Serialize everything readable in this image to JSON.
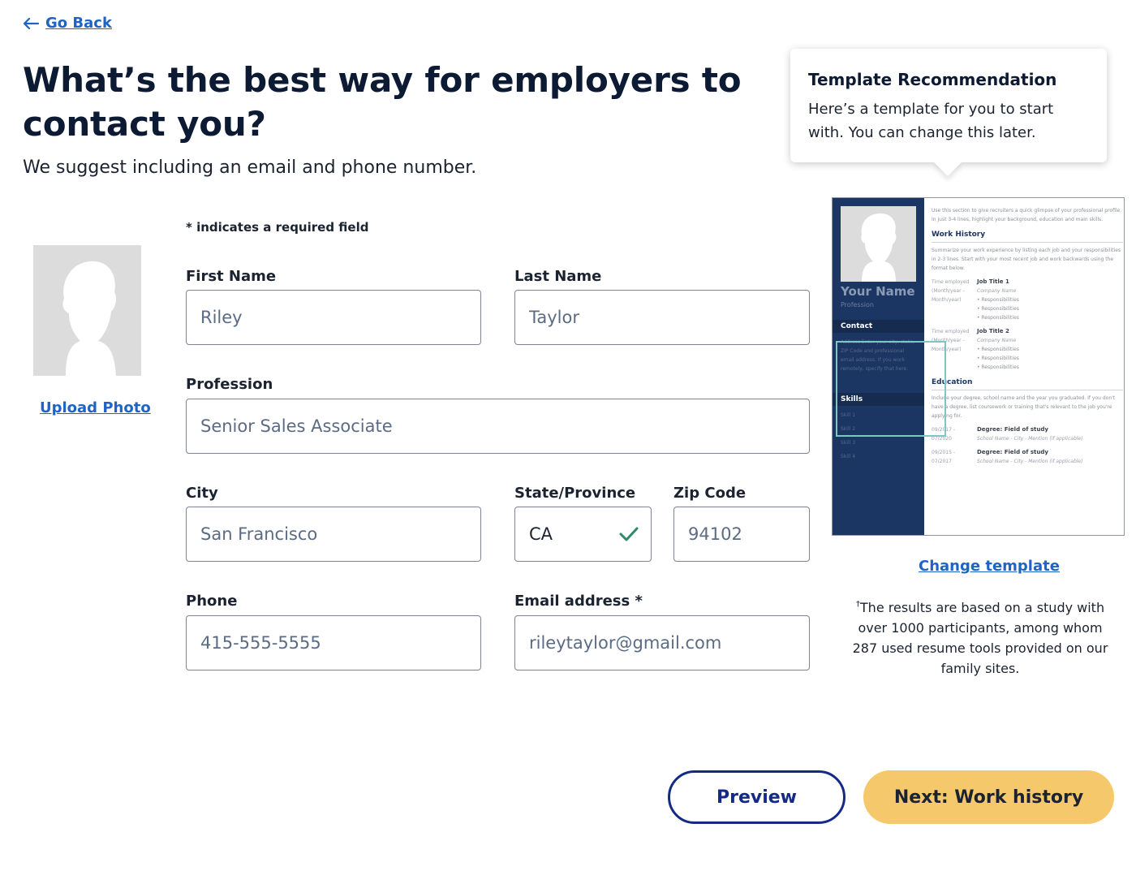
{
  "nav": {
    "back_label": "Go Back"
  },
  "header": {
    "title": "What’s the best way for employers to contact you?",
    "subtitle": "We suggest including an email and phone number."
  },
  "photo": {
    "upload_label": "Upload Photo"
  },
  "form": {
    "required_note": "* indicates a required field",
    "first_name": {
      "label": "First Name",
      "value": "Riley"
    },
    "last_name": {
      "label": "Last Name",
      "value": "Taylor"
    },
    "profession": {
      "label": "Profession",
      "value": "Senior Sales Associate"
    },
    "city": {
      "label": "City",
      "value": "San Francisco"
    },
    "state": {
      "label": "State/Province",
      "value": "CA",
      "valid": true
    },
    "zip": {
      "label": "Zip Code",
      "value": "94102"
    },
    "phone": {
      "label": "Phone",
      "value": "415-555-5555"
    },
    "email": {
      "label": "Email address *",
      "value": "rileytaylor@gmail.com"
    }
  },
  "tooltip": {
    "title": "Template Recommendation",
    "body": "Here’s a template for you to start with. You can change this later."
  },
  "template_preview": {
    "name": "Your Name",
    "profession": "Profession",
    "contact_heading": "Contact",
    "contact_text": "Address Enter your city, state, ZIP Code and professional email address. If you work remotely, specify that here.",
    "skills_heading": "Skills",
    "skills": [
      "Skill 1",
      "Skill 2",
      "Skill 3",
      "Skill 4"
    ],
    "summary": "Use this section to give recruiters a quick glimpse of your professional profile. In just 3-4 lines, highlight your background, education and main skills.",
    "work_heading": "Work History",
    "work_intro": "Summarize your work experience by listing each job and your responsibilities in 2-3 lines. Start with your most recent job and work backwards using the format below.",
    "jobs": [
      {
        "dates": "Time employed (Month/year - Month/year)",
        "title": "Job Title 1",
        "company": "Company Name",
        "bullets": [
          "Responsibilities",
          "Responsibilities",
          "Responsibilities"
        ]
      },
      {
        "dates": "Time employed (Month/year - Month/year)",
        "title": "Job Title 2",
        "company": "Company Name",
        "bullets": [
          "Responsibilities",
          "Responsibilities",
          "Responsibilities"
        ]
      }
    ],
    "education_heading": "Education",
    "education_intro": "Include your degree, school name and the year you graduated. If you don't have a degree, list coursework or training that's relevant to the job you're applying for.",
    "education": [
      {
        "dates": "09/2017 - 07/2020",
        "degree": "Degree: Field of study",
        "school": "School Name - City - Mention (if applicable)"
      },
      {
        "dates": "09/2015 - 07/2017",
        "degree": "Degree: Field of study",
        "school": "School Name - City - Mention (if applicable)"
      }
    ],
    "sidebar_color": "#1b3663"
  },
  "change_template_label": "Change template",
  "footnote": {
    "marker": "†",
    "text": "The results are based on a study with over 1000 participants, among whom 287 used resume tools provided on our family sites."
  },
  "actions": {
    "preview_label": "Preview",
    "next_label": "Next: Work history"
  },
  "colors": {
    "link": "#1f64c4",
    "primary_navy": "#142a86",
    "cta_yellow": "#f5c96b",
    "valid_green": "#2e8b6a"
  }
}
